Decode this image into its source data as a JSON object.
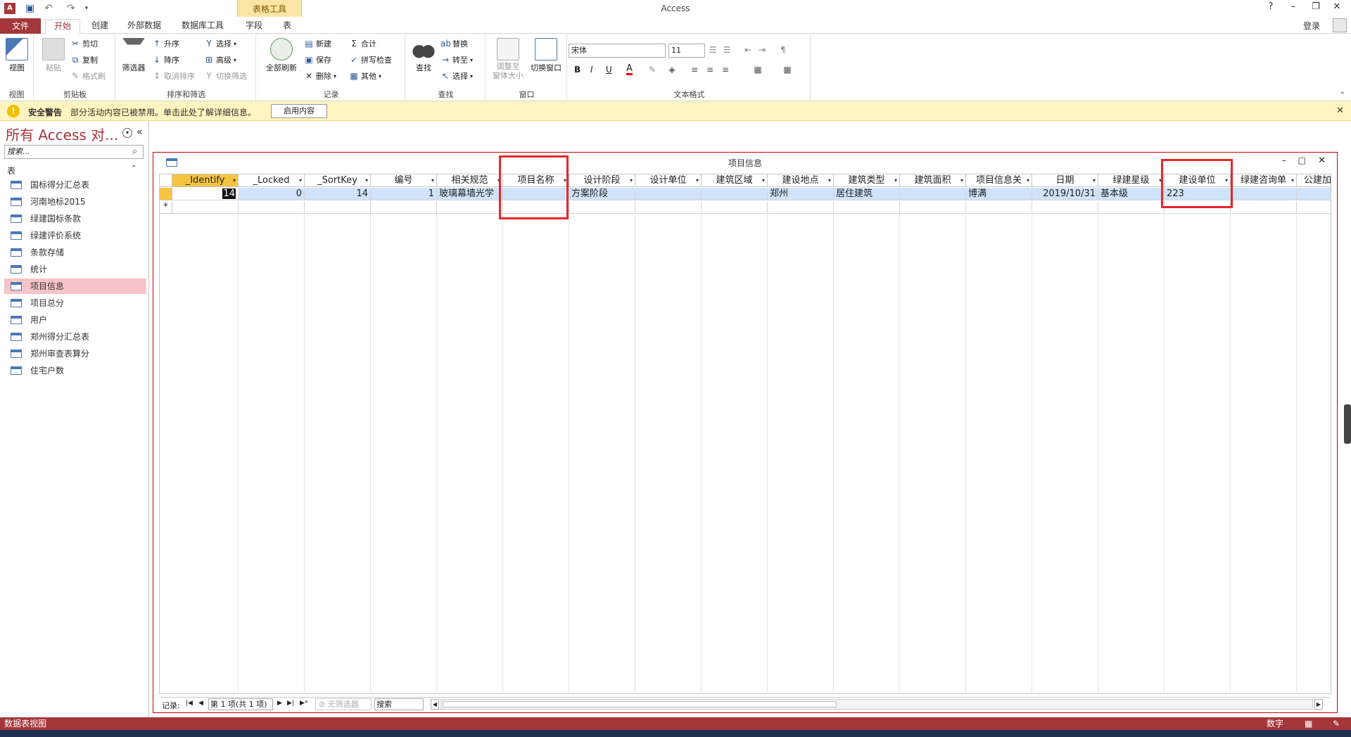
{
  "window": {
    "app_title": "Access",
    "help": "?",
    "login": "登录"
  },
  "tabs": {
    "file": "文件",
    "home": "开始",
    "create": "创建",
    "external": "外部数据",
    "dbtools": "数据库工具",
    "context_group": "表格工具",
    "fields": "字段",
    "table": "表"
  },
  "ribbon": {
    "view": {
      "btn": "视图",
      "group": "视图"
    },
    "clipboard": {
      "paste": "粘贴",
      "cut": "剪切",
      "copy": "复制",
      "format_painter": "格式刷",
      "group": "剪贴板"
    },
    "sort": {
      "filter": "筛选器",
      "asc": "升序",
      "desc": "降序",
      "clear_sort": "取消排序",
      "selection": "选择",
      "advanced": "高级",
      "toggle_filter": "切换筛选",
      "group": "排序和筛选"
    },
    "records": {
      "refresh_all": "全部刷新",
      "new": "新建",
      "save": "保存",
      "delete": "删除",
      "totals": "合计",
      "spelling": "拼写检查",
      "more": "其他",
      "group": "记录"
    },
    "find": {
      "find": "查找",
      "replace": "替换",
      "goto": "转至",
      "select": "选择",
      "group": "查找"
    },
    "window": {
      "size_to_fit": "调整至\n窗体大小",
      "switch": "切换窗口",
      "group": "窗口"
    },
    "text_format": {
      "font": "宋体",
      "size": "11",
      "bold": "B",
      "italic": "I",
      "underline": "U",
      "font_color": "A",
      "group": "文本格式"
    }
  },
  "security": {
    "title": "安全警告",
    "message": "部分活动内容已被禁用。单击此处了解详细信息。",
    "button": "启用内容"
  },
  "nav": {
    "title": "所有 Access 对...",
    "search_placeholder": "搜索...",
    "section": "表",
    "items": [
      "国标得分汇总表",
      "河南地标2015",
      "绿建国标条款",
      "绿建评价系统",
      "条款存储",
      "统计",
      "项目信息",
      "项目总分",
      "用户",
      "郑州得分汇总表",
      "郑州审查表算分",
      "住宅户数"
    ],
    "selected_index": 6
  },
  "document": {
    "title": "项目信息"
  },
  "grid": {
    "columns": [
      "_Identify",
      "_Locked",
      "_SortKey",
      "编号",
      "相关规范",
      "项目名称",
      "设计阶段",
      "设计单位",
      "建筑区域",
      "建设地点",
      "建筑类型",
      "建筑面积",
      "项目信息关",
      "日期",
      "绿建星级",
      "建设单位",
      "绿建咨询单",
      "公建加"
    ],
    "row": [
      "14",
      "0",
      "14",
      "1",
      "玻璃幕墙光学",
      "",
      "方案阶段",
      "",
      "",
      "郑州",
      "居住建筑",
      "",
      "博满",
      "2019/10/31",
      "基本级",
      "223",
      "",
      ""
    ],
    "new_row_marker": "*"
  },
  "record_nav": {
    "label": "记录:",
    "position": "第 1 项(共 1 项)",
    "filter": "无筛选器",
    "search": "搜索"
  },
  "status": {
    "view": "数据表视图",
    "mode": "数字"
  },
  "colors": {
    "accent": "#a4373a",
    "selection": "#f6c4c8",
    "highlight": "#e8262c"
  }
}
